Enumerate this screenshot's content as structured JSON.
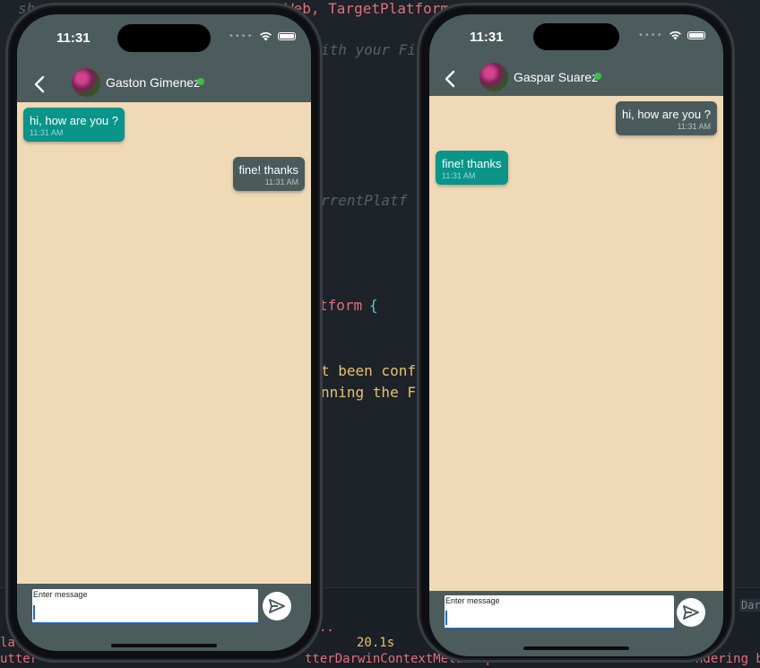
{
  "editor": {
    "lines": [
      {
        "text": "sh",
        "style": "c-italic"
      },
      {
        "text": "Web, TargetPlatform",
        "style": "c-red"
      },
      {
        "text": "ith your Fi",
        "style": "c-italic"
      },
      {
        "text": "rrentPlatf",
        "style": "c-italic"
      },
      {
        "text": "tform",
        "style": "c-red"
      },
      {
        "text": "{",
        "style": "c-cyan"
      },
      {
        "text": "t been confi",
        "style": "c-yellow"
      },
      {
        "text": "nning the F",
        "style": "c-yellow"
      },
      {
        "text": "20.1s",
        "style": "c-yellow"
      },
      {
        "text": "..",
        "style": "c-red"
      },
      {
        "text": "la",
        "style": "c-red"
      },
      {
        "text": "utter",
        "style": "c-red"
      },
      {
        "text": "tterDarwinContextMetalImp",
        "style": "c-red"
      },
      {
        "text": "ndering b",
        "style": "c-red"
      },
      {
        "text": "Dar",
        "style": "c-gray"
      }
    ]
  },
  "phones": [
    {
      "status": {
        "time": "11:31"
      },
      "header": {
        "contact_name": "Gaston Gimenez"
      },
      "messages": [
        {
          "direction": "incoming",
          "text": "hi, how are you ?",
          "time": "11:31 AM"
        },
        {
          "direction": "outgoing",
          "text": "fine! thanks",
          "time": "11:31 AM"
        }
      ],
      "composer": {
        "placeholder": "Enter message"
      }
    },
    {
      "status": {
        "time": "11:31"
      },
      "header": {
        "contact_name": "Gaspar Suarez"
      },
      "messages": [
        {
          "direction": "outgoing",
          "text": "hi, how are you ?",
          "time": "11:31 AM"
        },
        {
          "direction": "incoming",
          "text": "fine! thanks",
          "time": "11:31 AM"
        }
      ],
      "composer": {
        "placeholder": "Enter message"
      }
    }
  ],
  "colors": {
    "app_bar": "#4c5b5c",
    "chat_background": "#efd9b6",
    "incoming_bubble": "#0a948a",
    "outgoing_bubble": "#4b5b5c",
    "online_indicator": "#3fbf4a"
  }
}
